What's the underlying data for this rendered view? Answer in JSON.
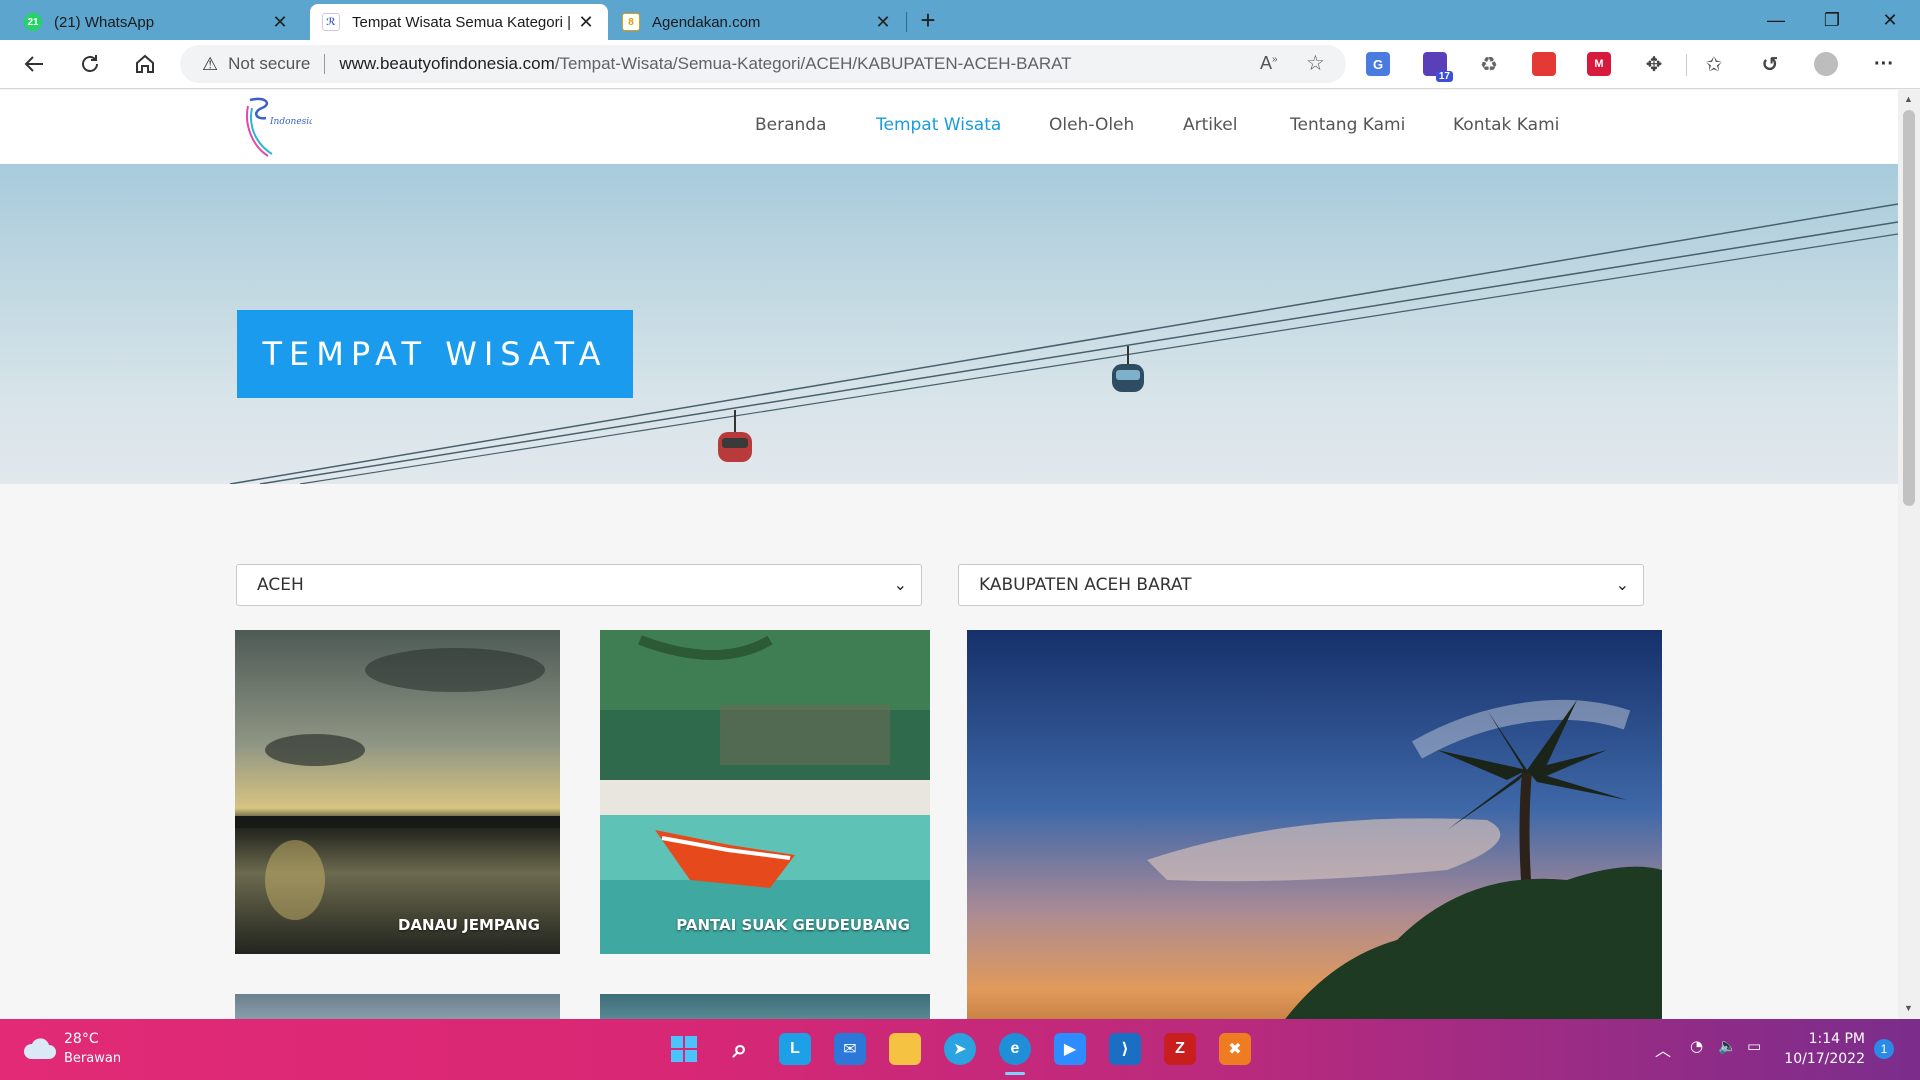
{
  "browser": {
    "tabs": [
      {
        "title": "(21) WhatsApp",
        "favicon": "whatsapp-icon",
        "badge": "21",
        "active": false
      },
      {
        "title": "Tempat Wisata Semua Kategori |",
        "favicon": "beauty-of-indonesia-icon",
        "active": true
      },
      {
        "title": "Agendakan.com",
        "favicon": "agendakan-icon",
        "active": false
      }
    ],
    "new_tab_label": "+",
    "address": {
      "security_label": "Not secure",
      "url_host": "www.beautyofindonesia.com",
      "url_path": "/Tempat-Wisata/Semua-Kategori/ACEH/KABUPATEN-ACEH-BARAT"
    },
    "extension_badge": "17"
  },
  "site": {
    "nav": [
      {
        "label": "Beranda",
        "active": false
      },
      {
        "label": "Tempat Wisata",
        "active": true
      },
      {
        "label": "Oleh-Oleh",
        "active": false
      },
      {
        "label": "Artikel",
        "active": false
      },
      {
        "label": "Tentang Kami",
        "active": false
      },
      {
        "label": "Kontak Kami",
        "active": false
      }
    ],
    "accent": "#1b9bed",
    "hero_title": "TEMPAT WISATA",
    "filters": {
      "province": "ACEH",
      "regency": "KABUPATEN ACEH BARAT"
    },
    "cards": [
      {
        "caption": "DANAU JEMPANG"
      },
      {
        "caption": "PANTAI SUAK GEUDEUBANG"
      }
    ]
  },
  "taskbar": {
    "weather_temp": "28°C",
    "weather_desc": "Berawan",
    "time": "1:14 PM",
    "date": "10/17/2022",
    "notification_count": "1"
  }
}
